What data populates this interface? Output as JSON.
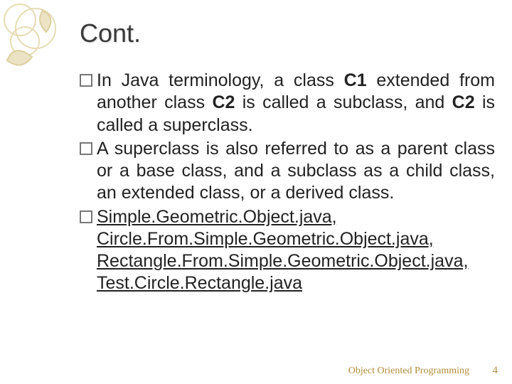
{
  "title": "Cont.",
  "bullets": [
    {
      "pre": "In Java terminology, a class ",
      "b1": "C1",
      "mid1": " extended from another class ",
      "b2": "C2",
      "mid2": " is called a ",
      "i1": "subclass",
      "mid3": ", and ",
      "b3": "C2",
      "mid4": " is called a ",
      "i2": "superclass",
      "post": "."
    },
    {
      "pre": "A superclass is also referred to as a ",
      "i1": "parent class",
      "mid1": " or a ",
      "i2": "base class",
      "mid2": ", and a subclass as a ",
      "i3": "child class",
      "mid3": ", an ",
      "i4": "extended class",
      "mid4": ", or a ",
      "i5": "derived class",
      "post": "."
    },
    {
      "l1": "Simple.Geometric.Object.java,",
      "l2": "Circle.From.Simple.Geometric.Object.java,",
      "l3": "Rectangle.From.Simple.Geometric.Object.java,",
      "l4": "Test.Circle.Rectangle.java"
    }
  ],
  "footer": {
    "text": "Object Oriented Programming",
    "page": "4"
  }
}
